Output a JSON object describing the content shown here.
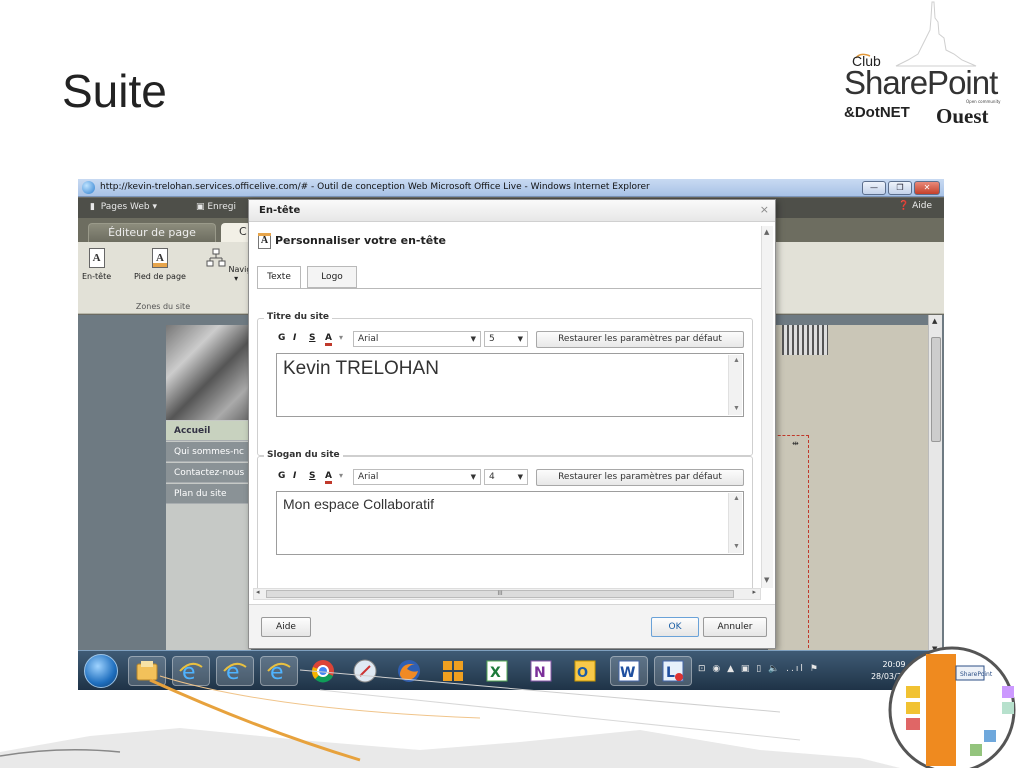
{
  "slide": {
    "title": "Suite"
  },
  "logo": {
    "club": "Club",
    "sharepoint": "SharePoint",
    "tagline": "Open community",
    "dotnet": "&DotNET",
    "ouest": "Ouest"
  },
  "browser": {
    "title": "http://kevin-trelohan.services.officelive.com/# - Outil de conception Web Microsoft Office Live - Windows Internet Explorer",
    "menu": {
      "pages_web": "Pages Web",
      "enregistrer": "Enregi",
      "aide": "Aide"
    },
    "tabs": {
      "editor": "Éditeur de page",
      "other": "C"
    },
    "ribbon": {
      "entete": "En-tête",
      "pied_de_page": "Pied de page",
      "navigation": "Navigatic",
      "group_label": "Zones du site"
    },
    "site_menu": [
      "Accueil",
      "Qui sommes-nc",
      "Contactez-nous",
      "Plan du site"
    ]
  },
  "dialog": {
    "title": "En-tête",
    "close": "×",
    "heading": "Personnaliser votre en-tête",
    "heading_icon_letter": "A",
    "tabs": [
      "Texte",
      "Logo"
    ],
    "site_title": {
      "legend": "Titre du site",
      "bold": "G",
      "italic": "I",
      "underline": "S",
      "color": "A",
      "font": "Arial",
      "size": "5",
      "restore": "Restaurer les paramètres par défaut",
      "value": "Kevin TRELOHAN"
    },
    "slogan": {
      "legend": "Slogan du site",
      "bold": "G",
      "italic": "I",
      "underline": "S",
      "color": "A",
      "font": "Arial",
      "size": "4",
      "restore": "Restaurer les paramètres par défaut",
      "value": "Mon espace Collaboratif"
    },
    "scroll_thumb": "III",
    "buttons": {
      "help": "Aide",
      "ok": "OK",
      "cancel": "Annuler"
    }
  },
  "taskbar": {
    "time": "20:09",
    "date": "28/03/2012",
    "apps": [
      "windows-explorer",
      "internet-explorer",
      "internet-explorer",
      "internet-explorer",
      "chrome",
      "safari",
      "firefox",
      "outlook",
      "excel",
      "onenote",
      "outlook",
      "word",
      "lync"
    ]
  },
  "badge": {
    "title": "SharePoint"
  }
}
